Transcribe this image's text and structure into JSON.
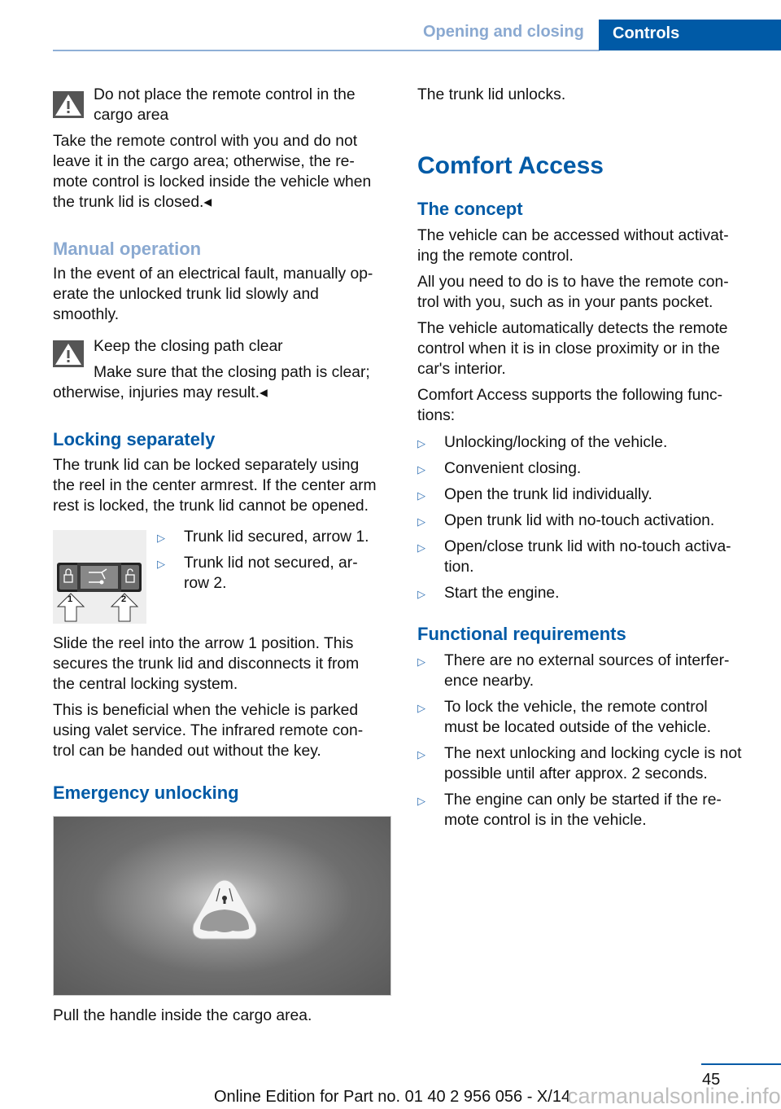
{
  "header": {
    "section": "Opening and closing",
    "chapter": "Controls",
    "accent_color": "#005aa6",
    "light_color": "#8aa9d1"
  },
  "left": {
    "warning1": {
      "title_line1": "Do not place the remote control in the",
      "title_line2": "cargo area",
      "body": [
        "Take the remote control with you and do not",
        "leave it in the cargo area; otherwise, the re-",
        "mote control is locked inside the vehicle when",
        "the trunk lid is closed.◂"
      ]
    },
    "manual": {
      "heading": "Manual operation",
      "body": [
        "In the event of an electrical fault, manually op-",
        "erate the unlocked trunk lid slowly and",
        "smoothly."
      ]
    },
    "warning2": {
      "title": "Keep the closing path clear",
      "body_line1": "Make sure that the closing path is clear;",
      "body_line2": "otherwise, injuries may result.◂"
    },
    "locking": {
      "heading": "Locking separately",
      "body": [
        "The trunk lid can be locked separately using",
        "the reel in the center armrest. If the center arm",
        "rest is locked, the trunk lid cannot be opened."
      ],
      "image_labels": [
        "1",
        "2"
      ],
      "bullets": [
        {
          "lines": [
            "Trunk lid secured, arrow 1."
          ]
        },
        {
          "lines": [
            "Trunk lid not secured, ar-",
            "row 2."
          ]
        }
      ],
      "para1": [
        "Slide the reel into the arrow 1 position. This",
        "secures the trunk lid and disconnects it from",
        "the central locking system."
      ],
      "para2": [
        "This is beneficial when the vehicle is parked",
        "using valet service. The infrared remote con-",
        "trol can be handed out without the key."
      ]
    },
    "emergency": {
      "heading": "Emergency unlocking",
      "caption": "Pull the handle inside the cargo area."
    }
  },
  "right": {
    "intro": "The trunk lid unlocks.",
    "comfort_heading": "Comfort Access",
    "concept_heading": "The concept",
    "concept_paras": [
      [
        "The vehicle can be accessed without activat-",
        "ing the remote control."
      ],
      [
        "All you need to do is to have the remote con-",
        "trol with you, such as in your pants pocket."
      ],
      [
        "The vehicle automatically detects the remote",
        "control when it is in close proximity or in the",
        "car's interior."
      ],
      [
        "Comfort Access supports the following func-",
        "tions:"
      ]
    ],
    "functions": [
      {
        "lines": [
          "Unlocking/locking of the vehicle."
        ]
      },
      {
        "lines": [
          "Convenient closing."
        ]
      },
      {
        "lines": [
          "Open the trunk lid individually."
        ]
      },
      {
        "lines": [
          "Open trunk lid with no-touch activation."
        ]
      },
      {
        "lines": [
          "Open/close trunk lid with no-touch activa-",
          "tion."
        ]
      },
      {
        "lines": [
          "Start the engine."
        ]
      }
    ],
    "requirements_heading": "Functional requirements",
    "requirements": [
      {
        "lines": [
          "There are no external sources of interfer-",
          "ence nearby."
        ]
      },
      {
        "lines": [
          "To lock the vehicle, the remote control",
          "must be located outside of the vehicle."
        ]
      },
      {
        "lines": [
          "The next unlocking and locking cycle is not",
          "possible until after approx. 2 seconds."
        ]
      },
      {
        "lines": [
          "The engine can only be started if the re-",
          "mote control is in the vehicle."
        ]
      }
    ]
  },
  "footer": {
    "page_number": "45",
    "edition": "Online Edition for Part no. 01 40 2 956 056 - X/14",
    "watermark": "carmanualsonline.info"
  }
}
